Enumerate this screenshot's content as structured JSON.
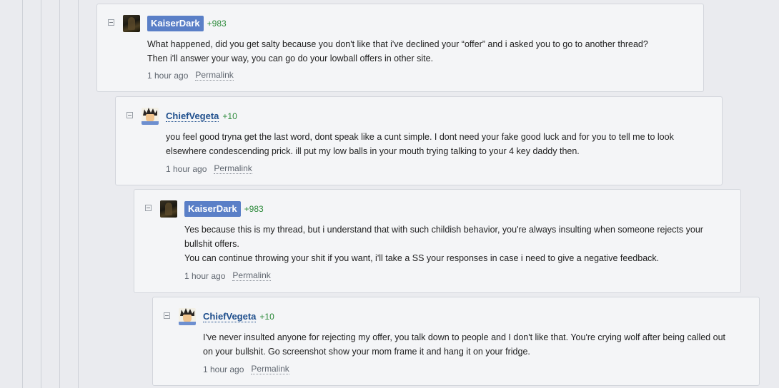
{
  "comments": [
    {
      "username": "KaiserDark",
      "rep": "+983",
      "lines": [
        "What happened, did you get salty because you don't like that i've declined your “offer” and i asked you to go to another thread?",
        "Then i'll answer your way, you can go do your lowball offers in other site."
      ],
      "time": "1 hour ago",
      "permalink": "Permalink"
    },
    {
      "username": "ChiefVegeta",
      "rep": "+10",
      "lines": [
        "you feel good tryna get the last word, dont speak like a cunt simple. I dont need your fake good luck and for you to tell me to look",
        "elsewhere condescending prick. ill put my low balls in your mouth trying talking to your 4 key daddy then."
      ],
      "time": "1 hour ago",
      "permalink": "Permalink"
    },
    {
      "username": "KaiserDark",
      "rep": "+983",
      "lines": [
        "Yes because this is my thread, but i understand that with such childish behavior, you're always insulting when someone rejects your",
        "bullshit offers.",
        "You can continue throwing your shit if you want, i'll take a SS your responses in case i need to give a negative feedback."
      ],
      "time": "1 hour ago",
      "permalink": "Permalink"
    },
    {
      "username": "ChiefVegeta",
      "rep": "+10",
      "lines": [
        "I've never insulted anyone for rejecting my offer, you talk down to people and I don't like that. You're crying wolf after being called out",
        "on your bullshit. Go screenshot show your mom frame it and hang it on your fridge."
      ],
      "time": "1 hour ago",
      "permalink": "Permalink"
    }
  ],
  "icons": {
    "collapse": "minus-square-icon",
    "avatar_kaiser": "dark-portrait-avatar",
    "avatar_vegeta": "vegeta-avatar"
  },
  "colors": {
    "username_badge": "#5a7fc7",
    "username_link": "#1f4f8d",
    "reputation": "#2c8a3a",
    "background": "#eaebef",
    "card": "#f4f5f7"
  }
}
